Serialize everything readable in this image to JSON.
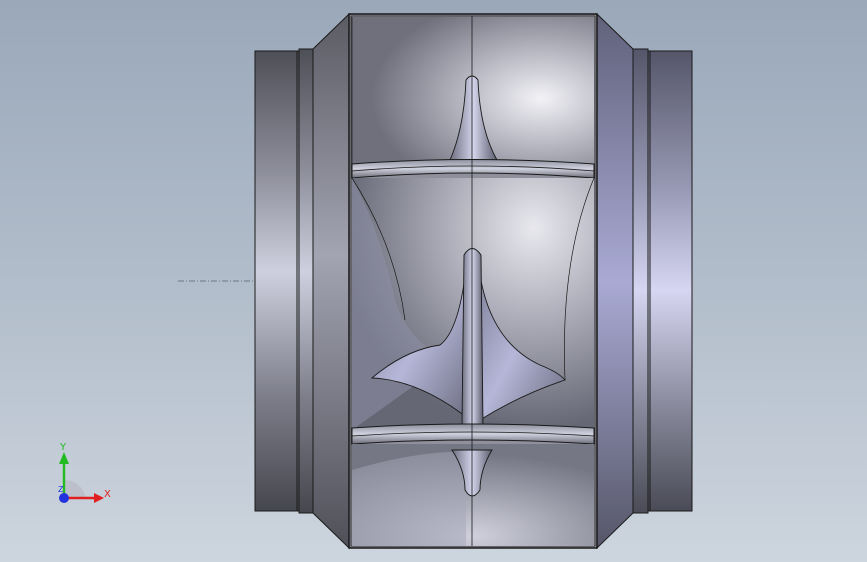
{
  "viewport": {
    "model": "centrifugal-fan-duct-section",
    "view": "front"
  },
  "triad": {
    "x_label": "X",
    "y_label": "Y",
    "z_label": "Z"
  },
  "colors": {
    "background_top": "#9aa8ba",
    "background_bottom": "#cdd5de",
    "edge": "#1a1a1a",
    "x_axis": "#e02020",
    "y_axis": "#22bb22",
    "z_axis": "#2233dd"
  },
  "icons": [
    "coordinate-triad-icon"
  ]
}
